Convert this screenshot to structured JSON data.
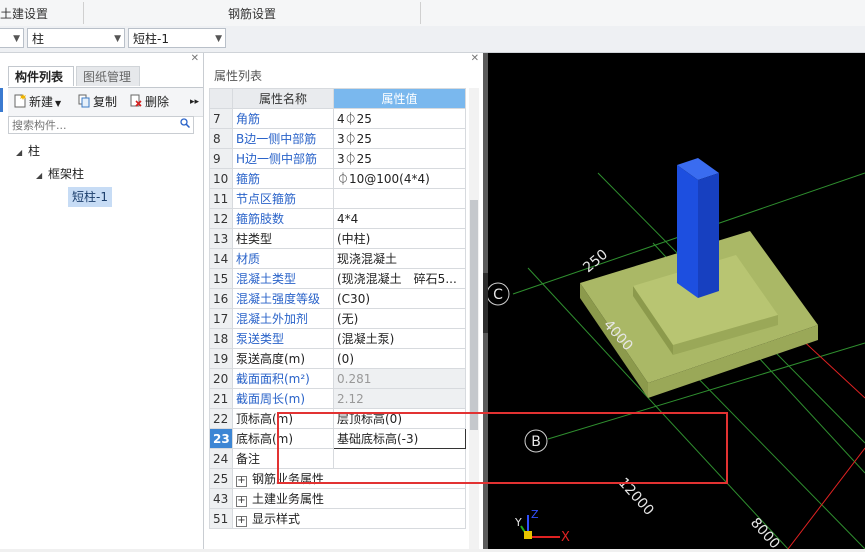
{
  "ribbon": {
    "group1": "土建设置",
    "group2": "钢筋设置"
  },
  "selector": {
    "category": "柱",
    "component": "短柱-1"
  },
  "left_panel": {
    "tabs": [
      {
        "label": "构件列表",
        "active": true
      },
      {
        "label": "图纸管理",
        "active": false
      }
    ],
    "toolbar": {
      "new_label": "新建",
      "copy_label": "复制",
      "delete_label": "删除",
      "more": "▸▸"
    },
    "search_placeholder": "搜索构件...",
    "tree": {
      "root": "柱",
      "child": "框架柱",
      "leaf": "短柱-1"
    }
  },
  "properties": {
    "title": "属性列表",
    "header_name": "属性名称",
    "header_value": "属性值",
    "rows": [
      {
        "num": "7",
        "name": "角筋",
        "value": "4⏀25",
        "style": "blue"
      },
      {
        "num": "8",
        "name": "B边一侧中部筋",
        "value": "3⏀25",
        "style": "blue"
      },
      {
        "num": "9",
        "name": "H边一侧中部筋",
        "value": "3⏀25",
        "style": "blue"
      },
      {
        "num": "10",
        "name": "箍筋",
        "value": "⏀10@100(4*4)",
        "style": "blue"
      },
      {
        "num": "11",
        "name": "节点区箍筋",
        "value": "",
        "style": "blue"
      },
      {
        "num": "12",
        "name": "箍筋肢数",
        "value": "4*4",
        "style": "blue"
      },
      {
        "num": "13",
        "name": "柱类型",
        "value": "(中柱)",
        "style": "normal"
      },
      {
        "num": "14",
        "name": "材质",
        "value": "现浇混凝土",
        "style": "blue"
      },
      {
        "num": "15",
        "name": "混凝土类型",
        "value": "(现浇混凝土　碎石5...",
        "style": "blue"
      },
      {
        "num": "16",
        "name": "混凝土强度等级",
        "value": "(C30)",
        "style": "blue"
      },
      {
        "num": "17",
        "name": "混凝土外加剂",
        "value": "(无)",
        "style": "blue"
      },
      {
        "num": "18",
        "name": "泵送类型",
        "value": "(混凝土泵)",
        "style": "blue"
      },
      {
        "num": "19",
        "name": "泵送高度(m)",
        "value": "(0)",
        "style": "normal"
      },
      {
        "num": "20",
        "name": "截面面积(m²)",
        "value": "0.281",
        "style": "blue-gray"
      },
      {
        "num": "21",
        "name": "截面周长(m)",
        "value": "2.12",
        "style": "blue-gray"
      },
      {
        "num": "22",
        "name": "顶标高(m)",
        "value": "层顶标高(0)",
        "style": "normal"
      },
      {
        "num": "23",
        "name": "底标高(m)",
        "value": "基础底标高(-3)",
        "style": "current"
      },
      {
        "num": "24",
        "name": "备注",
        "value": "",
        "style": "normal"
      },
      {
        "num": "25",
        "name": "钢筋业务属性",
        "value": "",
        "style": "group"
      },
      {
        "num": "43",
        "name": "土建业务属性",
        "value": "",
        "style": "group"
      },
      {
        "num": "51",
        "name": "显示样式",
        "value": "",
        "style": "group"
      }
    ]
  },
  "viewport": {
    "axis_c": "C",
    "axis_b": "B",
    "dim_250": "250",
    "dim_4000": "4000",
    "dim_12000": "12000",
    "dim_8000": "8000",
    "axis_x": "X",
    "axis_y": "Y",
    "axis_z": "Z",
    "colors": {
      "column": "#1d4fe0",
      "footing": "#aab866",
      "grid_green": "#2f8f2f",
      "grid_red": "#e02222"
    }
  }
}
